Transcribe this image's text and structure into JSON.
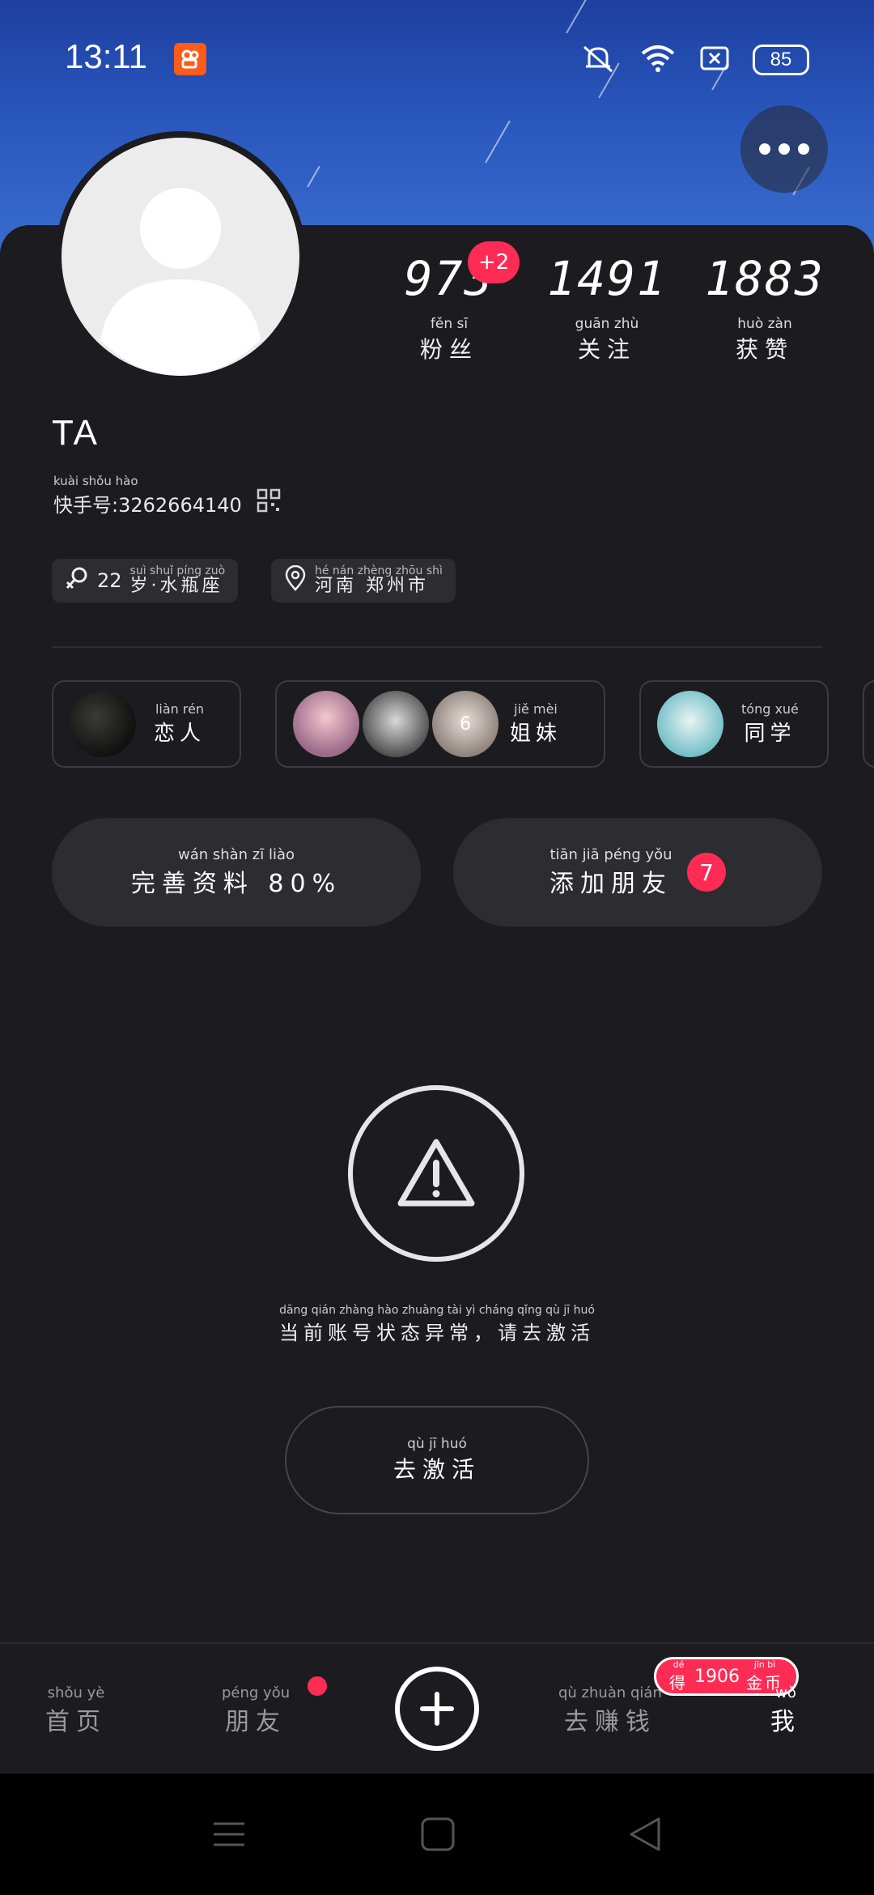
{
  "status_bar": {
    "time": "13:11",
    "battery": "85",
    "icons": [
      "kuaishou-app-icon",
      "mute-icon",
      "wifi-icon",
      "sim-icon",
      "battery-icon"
    ]
  },
  "profile": {
    "name": "TA",
    "stats": [
      {
        "value": "973",
        "pinyin": "fěn  sī",
        "label": "粉丝",
        "badge": "+2"
      },
      {
        "value": "1491",
        "pinyin": "guān zhù",
        "label": "关注"
      },
      {
        "value": "1883",
        "pinyin": "huò  zàn",
        "label": "获赞"
      }
    ],
    "kuaishou_id": {
      "pinyin": "kuài shǒu hào",
      "label": "快手号:",
      "value": "3262664140"
    },
    "tags": [
      {
        "prefix": "22",
        "pinyin": "suì   shuǐ píng zuò",
        "text": "岁·水瓶座"
      },
      {
        "pinyin": "hé  nán   zhèng zhōu  shì",
        "text": "河南 郑州市"
      }
    ]
  },
  "relations": [
    {
      "pinyin": "liàn  rén",
      "label": "恋人"
    },
    {
      "pinyin": "jiě   mèi",
      "label": "姐妹",
      "extra_count": "6"
    },
    {
      "pinyin": "tóng xué",
      "label": "同学"
    }
  ],
  "actions": {
    "complete_profile": {
      "pinyin": "wán shàn  zī   liào",
      "label": "完善资料",
      "percent": "80%"
    },
    "add_friends": {
      "pinyin": "tiān  jiā  péng yǒu",
      "label": "添加朋友",
      "count": "7"
    }
  },
  "warning": {
    "pinyin": "dāng qián zhàng hào zhuàng tài  yì  cháng    qǐng  qù   jī   huó",
    "text": "当前账号状态异常，请去激活",
    "button_pinyin": "qù   jī  huó",
    "button_label": "去激活"
  },
  "bottom_nav": {
    "home": {
      "pinyin": "shǒu  yè",
      "label": "首页"
    },
    "friends": {
      "pinyin": "péng yǒu",
      "label": "朋友"
    },
    "earn": {
      "pinyin": "qù  zhuàn qián",
      "label": "去赚钱"
    },
    "me": {
      "pinyin": "wǒ",
      "label": "我"
    },
    "coin_badge": {
      "pinyin": "dé",
      "text": "得",
      "amount": "1906",
      "unit_pinyin": "jīn  bì",
      "unit": "金币"
    }
  },
  "colors": {
    "accent": "#fe2c55",
    "background": "#1c1c20",
    "sky": "#2a57bd"
  }
}
